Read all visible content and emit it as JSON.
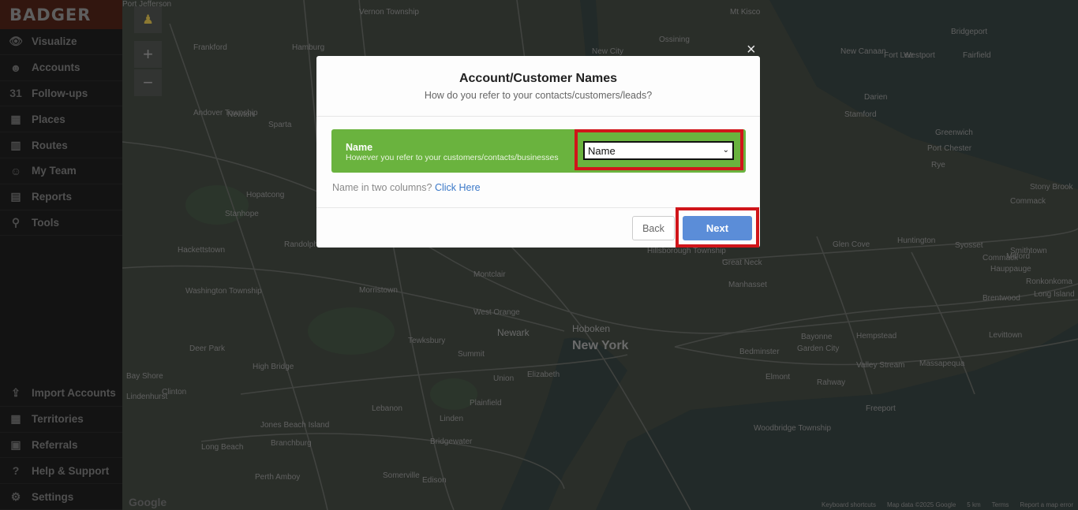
{
  "app": {
    "logo": "BADGER"
  },
  "sidebar": {
    "items": [
      {
        "label": "Visualize",
        "icon": "eye-icon",
        "glyph": "👁"
      },
      {
        "label": "Accounts",
        "icon": "user-icon",
        "glyph": "☻"
      },
      {
        "label": "Follow-ups",
        "icon": "calendar-icon",
        "glyph": "31"
      },
      {
        "label": "Places",
        "icon": "building-icon",
        "glyph": "▦"
      },
      {
        "label": "Routes",
        "icon": "map-icon",
        "glyph": "▥"
      },
      {
        "label": "My Team",
        "icon": "team-icon",
        "glyph": "☺"
      },
      {
        "label": "Reports",
        "icon": "chart-icon",
        "glyph": "▤"
      },
      {
        "label": "Tools",
        "icon": "tools-icon",
        "glyph": "⚲"
      }
    ],
    "bottom_items": [
      {
        "label": "Import Accounts",
        "icon": "upload-icon",
        "glyph": "⇪"
      },
      {
        "label": "Territories",
        "icon": "grid-icon",
        "glyph": "▦"
      },
      {
        "label": "Referrals",
        "icon": "gift-icon",
        "glyph": "▣"
      },
      {
        "label": "Help & Support",
        "icon": "help-icon",
        "glyph": "?"
      },
      {
        "label": "Settings",
        "icon": "gear-icon",
        "glyph": "⚙"
      }
    ]
  },
  "map": {
    "places": [
      "Vernon Township",
      "Frankford",
      "Hamburg",
      "Mt Kisco",
      "Bridgeport",
      "New Canaan",
      "Westport",
      "Fairfield",
      "New City",
      "Ossining",
      "Andover Township",
      "Newton",
      "Sparta",
      "Darien",
      "Stamford",
      "Greenwich",
      "Port Chester",
      "Rye",
      "Hopatcong",
      "Stanhope",
      "Randolph",
      "Huntington",
      "Glen Cove",
      "Syosset",
      "Commack",
      "Smithtown",
      "Hackettstown",
      "Washington Township",
      "Montclair",
      "Great Neck",
      "Manhasset",
      "Hauppauge",
      "Ronkonkoma",
      "Newark",
      "New York",
      "Hoboken",
      "Morristown",
      "West Orange",
      "Long Island",
      "Brentwood",
      "Deer Park",
      "Tewksbury",
      "Summit",
      "Union",
      "Elizabeth",
      "Bayonne",
      "Garden City",
      "Hempstead",
      "Levittown",
      "Bay Shore",
      "High Bridge",
      "Bedminster",
      "Elmont",
      "Valley Stream",
      "Massapequa",
      "Lindenhurst",
      "Clinton",
      "Lebanon",
      "Plainfield",
      "Linden",
      "Rahway",
      "Freeport",
      "Jones Beach Island",
      "Bridgewater",
      "Woodbridge Township",
      "Long Beach",
      "Branchburg",
      "Somerville",
      "Edison",
      "Perth Amboy",
      "Hillsborough Township",
      "Fort Lee",
      "Milford",
      "Commack",
      "Stony Brook",
      "Port Jefferson"
    ],
    "zoom_in": "+",
    "zoom_out": "−",
    "footer": [
      "Keyboard shortcuts",
      "Map data ©2025 Google",
      "5 km",
      "Terms",
      "Report a map error"
    ],
    "google": "Google"
  },
  "modal": {
    "close": "×",
    "title": "Account/Customer Names",
    "subtitle": "How do you refer to your contacts/customers/leads?",
    "field": {
      "title": "Name",
      "description": "However you refer to your customers/contacts/businesses",
      "selected": "Name"
    },
    "two_columns_text": "Name in two columns?",
    "two_columns_link": "Click Here",
    "back_label": "Back",
    "next_label": "Next"
  }
}
